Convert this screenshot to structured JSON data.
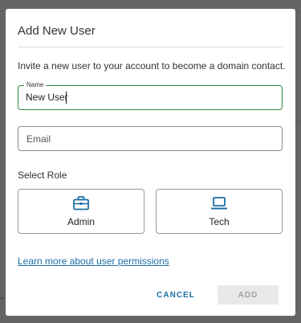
{
  "dialog": {
    "title": "Add New User",
    "description": "Invite a new user to your account to become a domain contact."
  },
  "name_field": {
    "label": "Name",
    "value": "New User"
  },
  "email_field": {
    "placeholder": "Email",
    "value": ""
  },
  "role": {
    "heading": "Select Role",
    "options": [
      {
        "label": "Admin",
        "icon": "briefcase-icon"
      },
      {
        "label": "Tech",
        "icon": "laptop-icon"
      }
    ],
    "icon_color": "#1b6fa3"
  },
  "learn_more_link": "Learn more about user permissions",
  "actions": {
    "cancel_label": "CANCEL",
    "add_label": "ADD"
  },
  "colors": {
    "accent": "#1b6fa3",
    "focus_border": "#2e8b43",
    "disabled_bg": "#e8e8e8"
  }
}
